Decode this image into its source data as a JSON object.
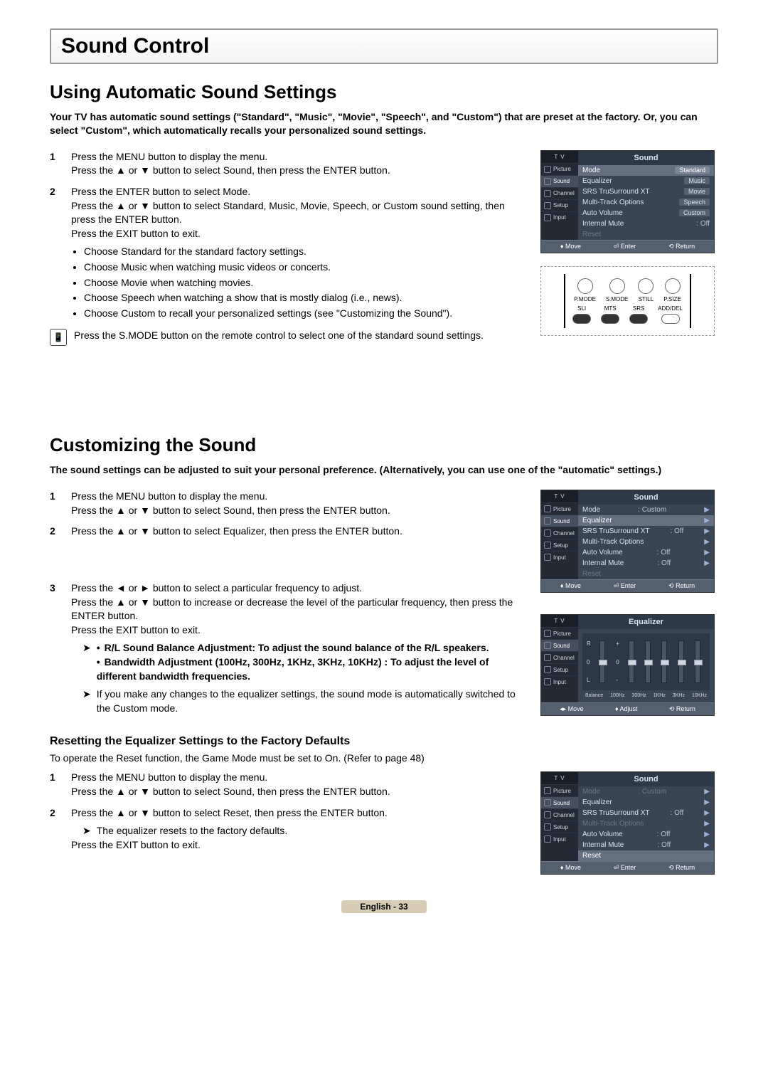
{
  "page": {
    "section_title": "Sound Control",
    "footer": "English - 33"
  },
  "auto": {
    "heading": "Using Automatic Sound Settings",
    "intro": "Your TV has automatic sound settings (\"Standard\", \"Music\", \"Movie\", \"Speech\", and \"Custom\") that are preset at the factory. Or, you can select \"Custom\", which automatically recalls your personalized sound settings.",
    "steps": [
      {
        "num": "1",
        "lines": [
          "Press the MENU button to display the menu.",
          "Press the ▲ or ▼ button to select Sound, then press the ENTER button."
        ]
      },
      {
        "num": "2",
        "lines": [
          "Press the ENTER button to select Mode.",
          "Press the ▲ or ▼ button to select Standard, Music, Movie, Speech, or Custom sound setting, then press the ENTER button.",
          "Press the EXIT button to exit."
        ],
        "bullets": [
          "Choose Standard for the standard factory settings.",
          "Choose Music when watching music videos or concerts.",
          "Choose Movie when watching movies.",
          "Choose Speech when watching a show that is mostly dialog (i.e., news).",
          "Choose Custom to recall your personalized settings (see \"Customizing the Sound\")."
        ]
      }
    ],
    "smode_note": "Press the S.MODE button on the remote control to select one of the standard sound settings."
  },
  "custom": {
    "heading": "Customizing the Sound",
    "intro": "The sound settings can be adjusted to suit your personal preference. (Alternatively, you can use one of the \"automatic\" settings.)",
    "steps": [
      {
        "num": "1",
        "lines": [
          "Press the MENU button to display the menu.",
          "Press the ▲ or ▼ button to select Sound, then press the ENTER button."
        ]
      },
      {
        "num": "2",
        "lines": [
          "Press the ▲ or ▼ button to select Equalizer, then press the ENTER button."
        ]
      },
      {
        "num": "3",
        "lines": [
          "Press the ◄ or ► button to select a particular frequency to adjust.",
          "Press the ▲ or ▼ button to increase or decrease the level of the particular frequency, then press the ENTER button.",
          "Press the EXIT button to exit."
        ]
      }
    ],
    "arrow_notes": [
      "R/L Sound Balance Adjustment: To adjust the sound balance of the R/L speakers.",
      "Bandwidth Adjustment (100Hz, 300Hz, 1KHz, 3KHz, 10KHz) : To adjust the level of different bandwidth frequencies."
    ],
    "switch_note": "If you make any changes to the equalizer settings, the sound mode is automatically switched to the Custom mode."
  },
  "reset": {
    "heading": "Resetting the Equalizer Settings to the Factory Defaults",
    "intro": "To operate the Reset function, the Game Mode must be set to On. (Refer to page 48)",
    "steps": [
      {
        "num": "1",
        "lines": [
          "Press the MENU button to display the menu.",
          "Press the ▲ or ▼ button to select Sound, then press the ENTER button."
        ]
      },
      {
        "num": "2",
        "lines": [
          "Press the ▲ or ▼ button to select Reset, then press the ENTER button."
        ],
        "arrow": "The equalizer resets to the factory defaults.",
        "after": "Press the EXIT button to exit."
      }
    ]
  },
  "osd": {
    "tv_label": "T V",
    "side_items": [
      "Picture",
      "Sound",
      "Channel",
      "Setup",
      "Input"
    ],
    "sound_title": "Sound",
    "eq_title": "Equalizer",
    "mode_options": [
      "Standard",
      "Music",
      "Movie",
      "Speech",
      "Custom"
    ],
    "menu1_rows": [
      {
        "label": "Mode",
        "val": ""
      },
      {
        "label": "Equalizer",
        "val": ""
      },
      {
        "label": "SRS TruSurround XT",
        "val": ""
      },
      {
        "label": "Multi-Track Options",
        "val": ""
      },
      {
        "label": "Auto Volume",
        "val": ""
      },
      {
        "label": "Internal Mute",
        "val": ": Off"
      },
      {
        "label": "Reset",
        "val": ""
      }
    ],
    "menu2_rows": [
      {
        "label": "Mode",
        "val": ": Custom"
      },
      {
        "label": "Equalizer",
        "val": ""
      },
      {
        "label": "SRS TruSurround XT",
        "val": ": Off"
      },
      {
        "label": "Multi-Track Options",
        "val": ""
      },
      {
        "label": "Auto Volume",
        "val": ": Off"
      },
      {
        "label": "Internal Mute",
        "val": ": Off"
      },
      {
        "label": "Reset",
        "val": ""
      }
    ],
    "menu3_rows": [
      {
        "label": "Mode",
        "val": ": Custom",
        "dim": true
      },
      {
        "label": "Equalizer",
        "val": ""
      },
      {
        "label": "SRS TruSurround XT",
        "val": ": Off"
      },
      {
        "label": "Multi-Track Options",
        "val": "",
        "dim": true
      },
      {
        "label": "Auto Volume",
        "val": ": Off"
      },
      {
        "label": "Internal Mute",
        "val": ": Off"
      },
      {
        "label": "Reset",
        "val": ""
      }
    ],
    "eq_bands": [
      "Balance",
      "100Hz",
      "300Hz",
      "1KHz",
      "3KHz",
      "10KHz"
    ],
    "foot_move": "Move",
    "foot_enter": "Enter",
    "foot_return": "Return",
    "foot_adjust": "Adjust"
  },
  "remote": {
    "row1": [
      "P.MODE",
      "S.MODE",
      "STILL",
      "P.SIZE"
    ],
    "row2": [
      "SLI",
      "MTS",
      "SRS",
      "ADD/DEL"
    ]
  }
}
